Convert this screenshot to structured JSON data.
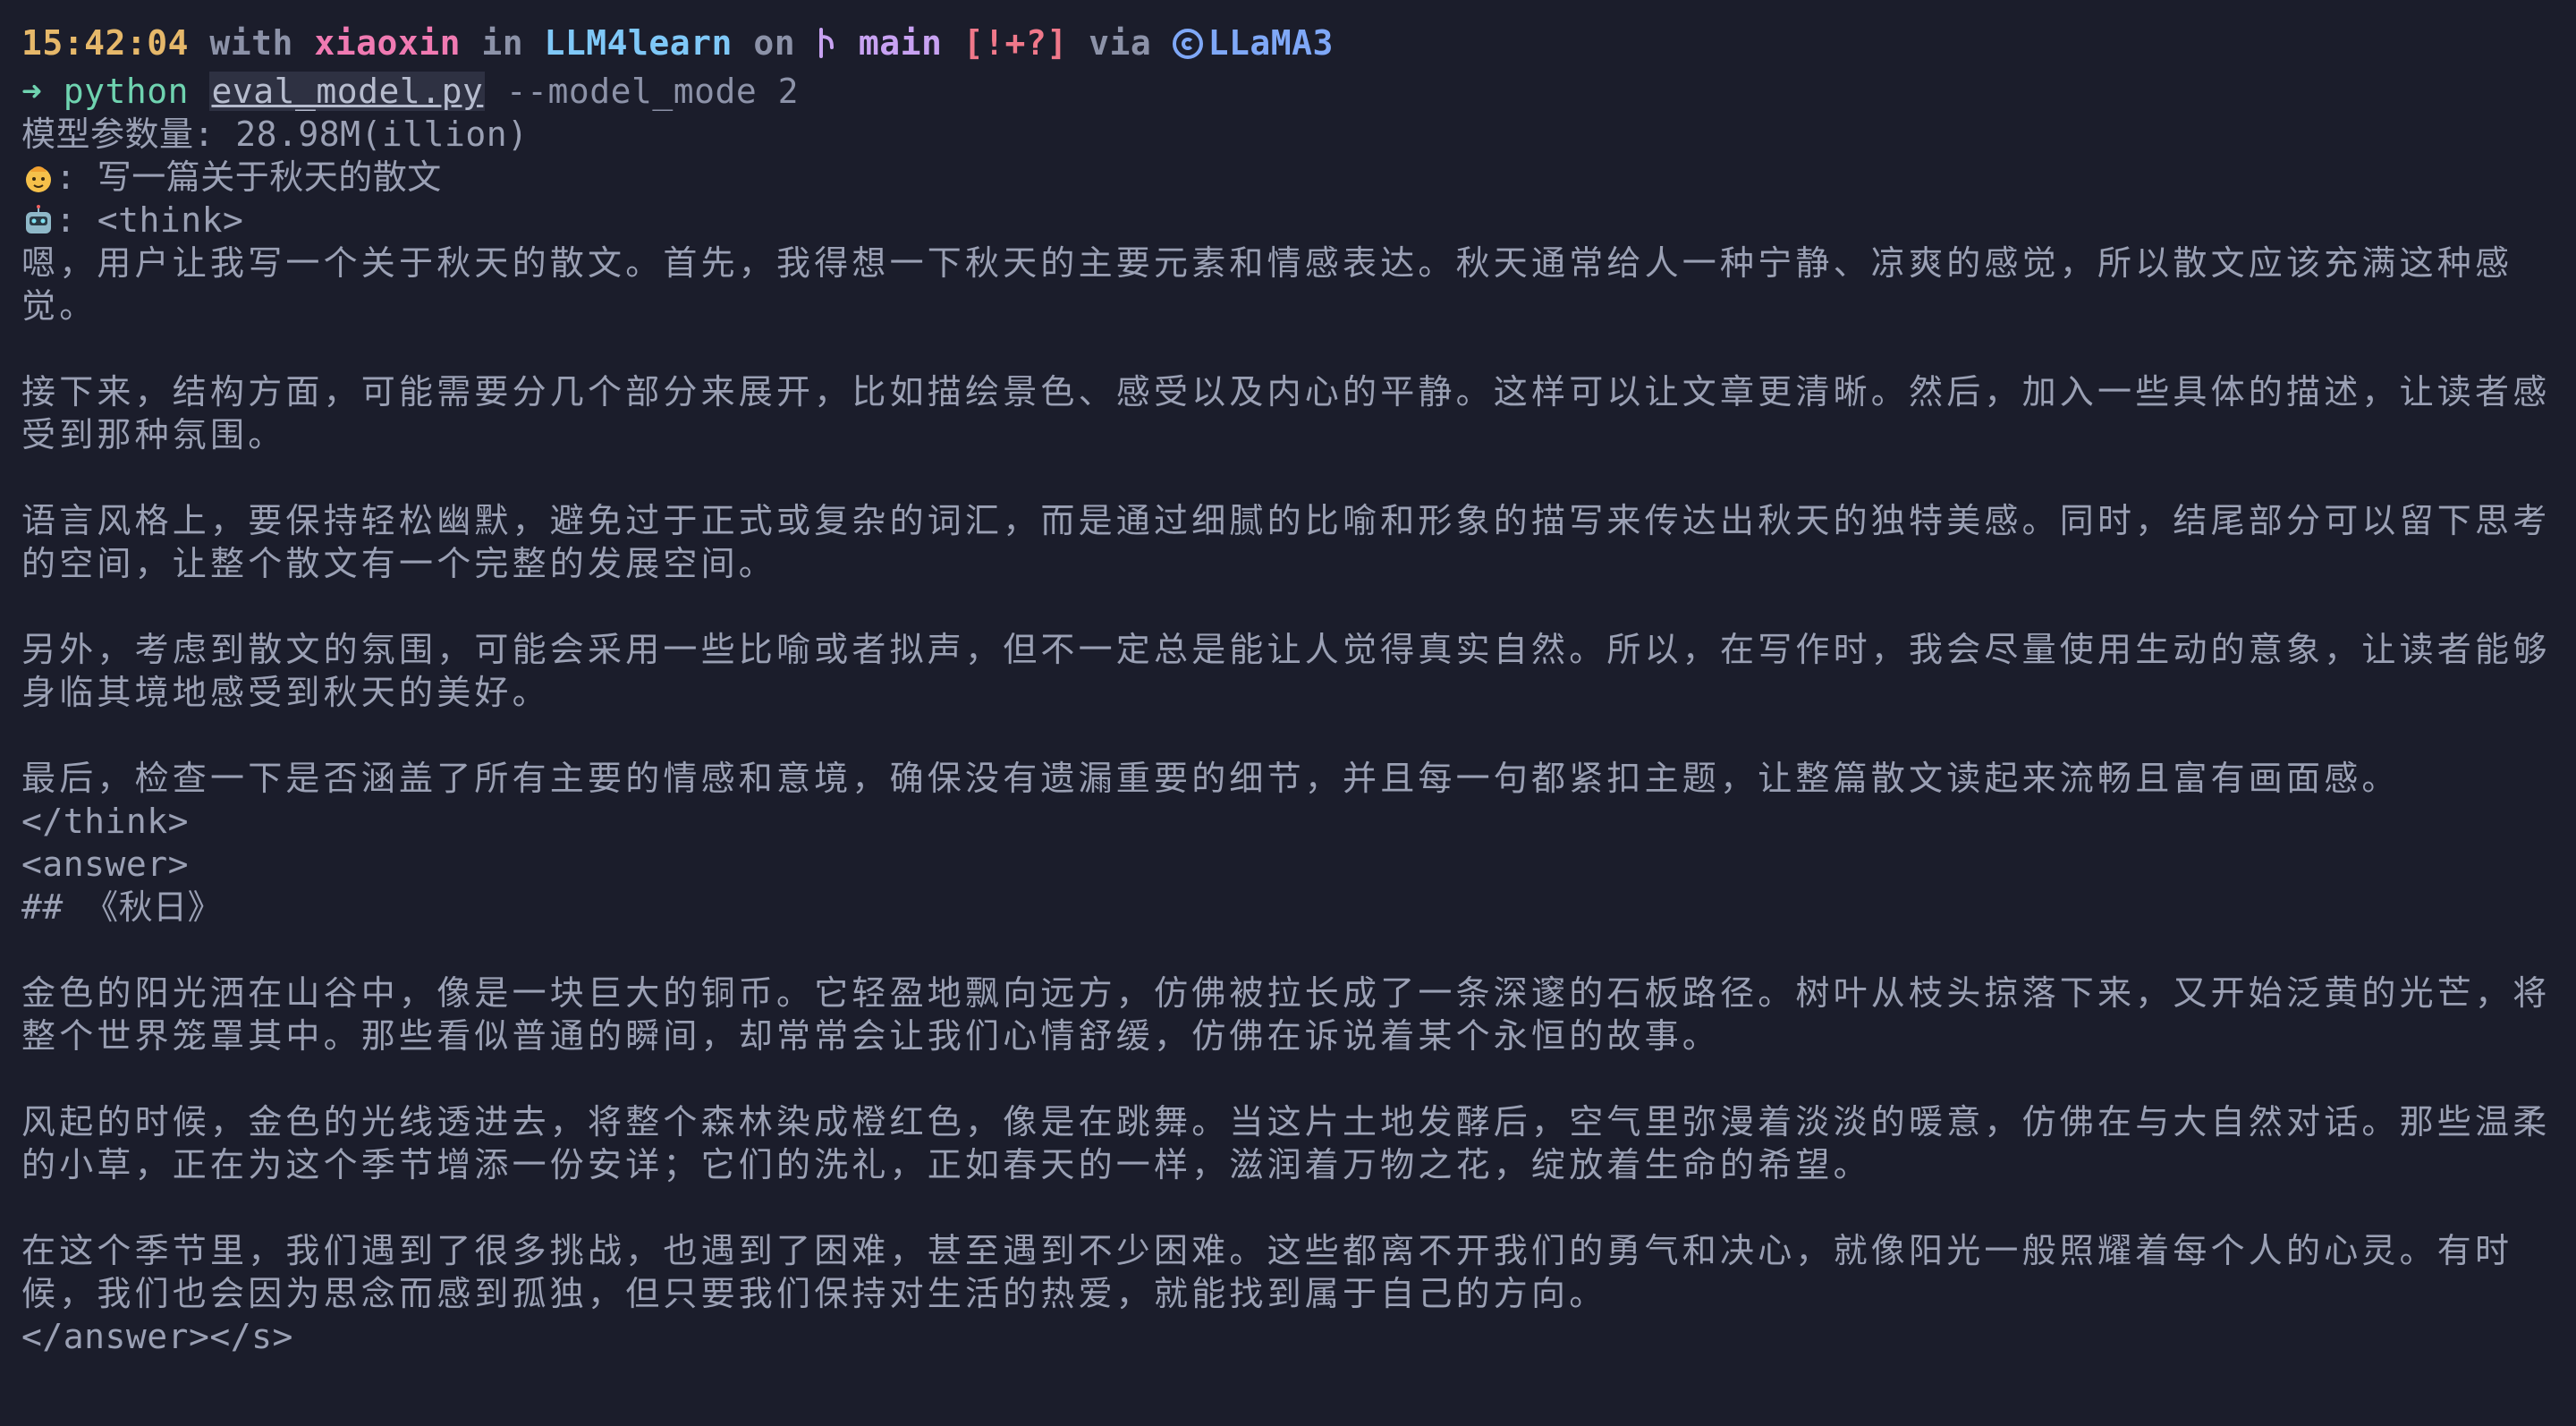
{
  "prompt": {
    "time": "15:42:04",
    "with_word": "with",
    "user": "xiaoxin",
    "in_word": "in",
    "dir": "LLM4learn",
    "on_word": "on",
    "branch_icon": "git-branch-icon",
    "branch": "main",
    "git_status": "[!+?]",
    "via_word": "via",
    "env_icon": "conda-icon",
    "env": "LLaMA3"
  },
  "command": {
    "arrow": "➜",
    "program": "python",
    "file": "eval_model.py",
    "args": "--model_mode 2"
  },
  "output": {
    "param_line": "模型参数量: 28.98M(illion)",
    "user_icon": "baby-face-icon",
    "user_line": ": 写一篇关于秋天的散文",
    "bot_icon": "robot-icon",
    "bot_line": ": <think>",
    "think_paragraphs": [
      "嗯，用户让我写一个关于秋天的散文。首先，我得想一下秋天的主要元素和情感表达。秋天通常给人一种宁静、凉爽的感觉，所以散文应该充满这种感觉。",
      "接下来，结构方面，可能需要分几个部分来展开，比如描绘景色、感受以及内心的平静。这样可以让文章更清晰。然后，加入一些具体的描述，让读者感受到那种氛围。",
      "语言风格上，要保持轻松幽默，避免过于正式或复杂的词汇，而是通过细腻的比喻和形象的描写来传达出秋天的独特美感。同时，结尾部分可以留下思考的空间，让整个散文有一个完整的发展空间。",
      "另外，考虑到散文的氛围，可能会采用一些比喻或者拟声，但不一定总是能让人觉得真实自然。所以，在写作时，我会尽量使用生动的意象，让读者能够身临其境地感受到秋天的美好。",
      "最后，检查一下是否涵盖了所有主要的情感和意境，确保没有遗漏重要的细节，并且每一句都紧扣主题，让整篇散文读起来流畅且富有画面感。"
    ],
    "think_close": "</think>",
    "answer_open": "<answer>",
    "heading": "## 《秋日》",
    "answer_paragraphs": [
      "金色的阳光洒在山谷中，像是一块巨大的铜币。它轻盈地飘向远方，仿佛被拉长成了一条深邃的石板路径。树叶从枝头掠落下来，又开始泛黄的光芒，将整个世界笼罩其中。那些看似普通的瞬间，却常常会让我们心情舒缓，仿佛在诉说着某个永恒的故事。",
      "风起的时候，金色的光线透进去，将整个森林染成橙红色，像是在跳舞。当这片土地发酵后，空气里弥漫着淡淡的暖意，仿佛在与大自然对话。那些温柔的小草，正在为这个季节增添一份安详；它们的洗礼，正如春天的一样，滋润着万物之花，绽放着生命的希望。",
      "在这个季节里，我们遇到了很多挑战，也遇到了困难，甚至遇到不少困难。这些都离不开我们的勇气和决心，就像阳光一般照耀着每个人的心灵。有时候，我们也会因为思念而感到孤独，但只要我们保持对生活的热爱，就能找到属于自己的方向。"
    ],
    "answer_close": "</answer></s>"
  }
}
